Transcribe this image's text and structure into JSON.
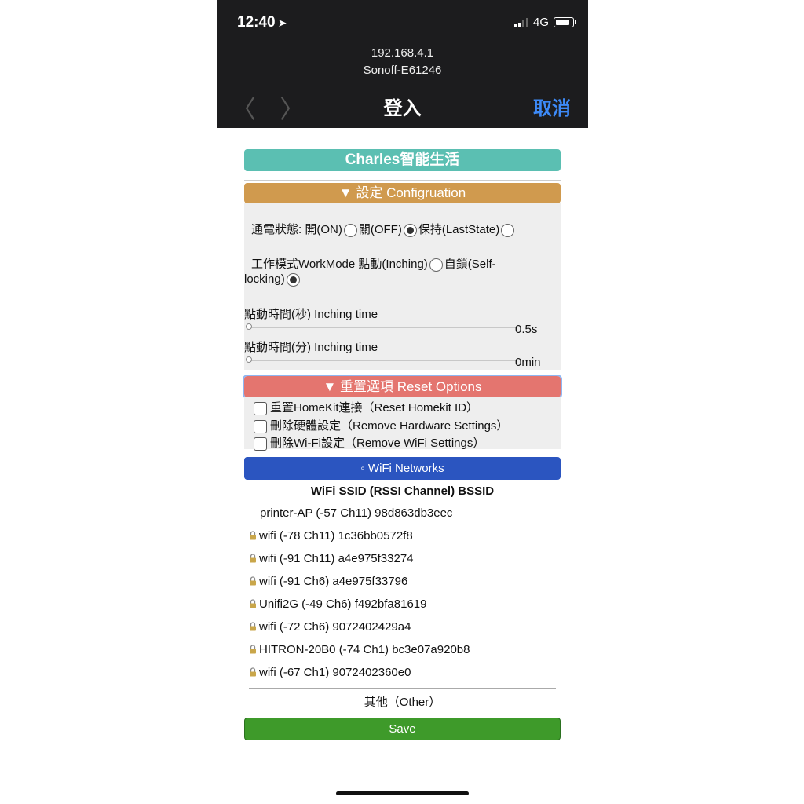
{
  "status_bar": {
    "time": "12:40",
    "location_glyph": "➤",
    "network": "4G"
  },
  "browser": {
    "host": "192.168.4.1",
    "page_title": "Sonoff-E61246",
    "nav_title": "登入",
    "cancel_label": "取消",
    "back_glyph": "〈",
    "forward_glyph": "〉"
  },
  "app": {
    "title": "Charles智能生活",
    "brand_color": "#5bbfb2"
  },
  "config": {
    "header": "▼ 設定 Configruation",
    "header_color": "#d09a4e",
    "power_state_label": "通電狀態:",
    "power_options": [
      "開(ON)",
      "關(OFF)",
      "保持(LastState)"
    ],
    "power_selected": "關(OFF)",
    "workmode_label": "工作模式WorkMode",
    "workmode_option1": "點動(Inching)",
    "workmode_option2_part1": "自鎖(Self-",
    "workmode_option2_part2": "locking)",
    "workmode_selected": "自鎖(Self-locking)",
    "inching_sec_label": "點動時間(秒) Inching time",
    "inching_sec_value": "0.5s",
    "inching_min_label": "點動時間(分) Inching time",
    "inching_min_value": "0min"
  },
  "reset": {
    "header": "▼ 重置選項 Reset Options",
    "header_color": "#e4756f",
    "options": [
      "重置HomeKit連接（Reset Homekit ID）",
      "刪除硬體設定（Remove Hardware Settings）",
      "刪除Wi-Fi設定（Remove WiFi Settings）"
    ]
  },
  "wifi": {
    "button_label": "◦ WiFi Networks",
    "button_color": "#2b55c0",
    "table_header": "WiFi SSID (RSSI Channel) BSSID",
    "networks": [
      {
        "text": "printer-AP (-57 Ch11) 98d863db3eec",
        "locked": false
      },
      {
        "text": "wifi (-78 Ch11) 1c36bb0572f8",
        "locked": true
      },
      {
        "text": "wifi (-91 Ch11) a4e975f33274",
        "locked": true
      },
      {
        "text": "wifi (-91 Ch6) a4e975f33796",
        "locked": true
      },
      {
        "text": "Unifi2G (-49 Ch6) f492bfa81619",
        "locked": true
      },
      {
        "text": "wifi (-72 Ch6) 9072402429a4",
        "locked": true
      },
      {
        "text": "HITRON-20B0 (-74 Ch1) bc3e07a920b8",
        "locked": true
      },
      {
        "text": "wifi (-67 Ch1) 9072402360e0",
        "locked": true
      }
    ],
    "other_label": "其他（Other）"
  },
  "save": {
    "label": "Save",
    "color": "#3e9a2a"
  }
}
